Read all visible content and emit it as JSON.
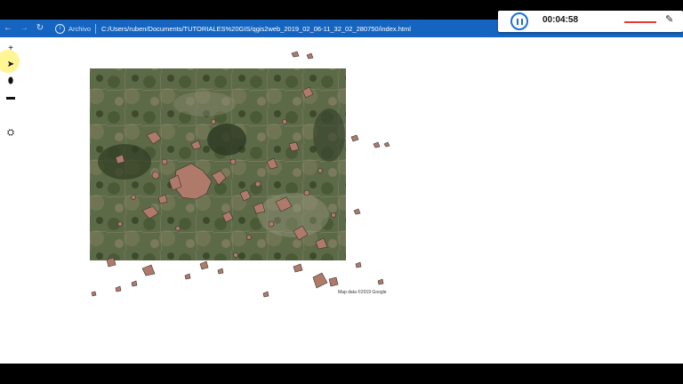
{
  "browser": {
    "back_icon": "arrow-left-icon",
    "forward_icon": "arrow-right-icon",
    "reload_icon": "reload-icon",
    "info_icon": "info-icon",
    "archivo_label": "Archivo",
    "url": "C:/Users/ruben/Documents/TUTORIALES%20GIS/qgis2web_2019_02_06-11_32_02_280750/index.html"
  },
  "recorder": {
    "timer": "00:04:58",
    "pause_icon": "pause-icon",
    "webcam_icon": "webcam-icon",
    "accent": "#1e6fd9",
    "record_color": "#e53935"
  },
  "map": {
    "tools": [
      {
        "name": "zoom-in-tool",
        "glyph": "+"
      },
      {
        "name": "pointer-tool",
        "glyph": "➤"
      },
      {
        "name": "marker-tool",
        "glyph": "⬮"
      },
      {
        "name": "measure-tool",
        "glyph": "▬"
      },
      {
        "name": "search-tool",
        "glyph": "⛭"
      }
    ],
    "polygon_fill": "#b07a6a",
    "polygon_stroke": "#333333",
    "attribution": "Map data ©2019 Google"
  }
}
